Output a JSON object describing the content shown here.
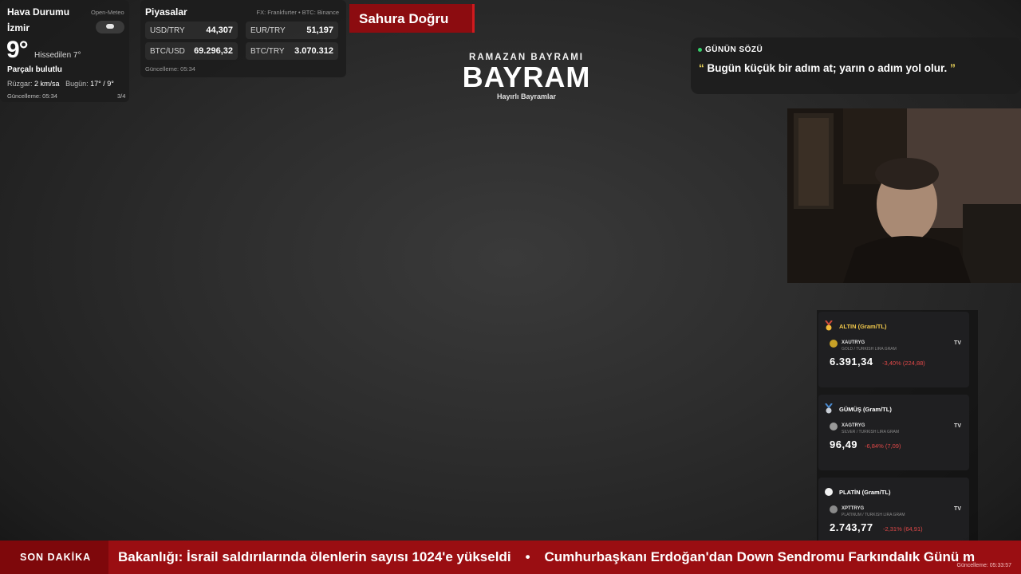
{
  "weather": {
    "title": "Hava Durumu",
    "source": "Open-Meteo",
    "city": "İzmir",
    "temperature": "9°",
    "feels_like": "Hissedilen 7°",
    "condition": "Parçalı bulutlu",
    "wind_label": "Rüzgar:",
    "wind_value": "2 km/sa",
    "today_label": "Bugün:",
    "today_value": "17° / 9°",
    "updated": "Güncelleme: 05:34",
    "page": "3/4",
    "icon": "partly-cloudy-icon"
  },
  "markets": {
    "title": "Piyasalar",
    "source": "FX: Frankfurter • BTC: Binance",
    "items": [
      {
        "label": "USD/TRY",
        "value": "44,307"
      },
      {
        "label": "EUR/TRY",
        "value": "51,197"
      },
      {
        "label": "BTC/USD",
        "value": "69.296,32"
      },
      {
        "label": "BTC/TRY",
        "value": "3.070.312"
      }
    ],
    "updated": "Güncelleme: 05:34"
  },
  "banner": {
    "sahura": "Sahura Doğru"
  },
  "center": {
    "subtitle": "RAMAZAN BAYRAMI",
    "title": "BAYRAM",
    "caption": "Hayırlı Bayramlar"
  },
  "quote": {
    "heading": "GÜNÜN SÖZÜ",
    "open_mark": "“",
    "text": "Bugün küçük bir adım at; yarın o adım yol olur.",
    "close_mark": "”"
  },
  "metals": [
    {
      "name": "ALTIN (Gram/TL)",
      "ticker": "XAUTRYG",
      "desc": "GOLD / TURKISH LIRA GRAM",
      "price": "6.391,34",
      "change": "-3,40% (224,88)",
      "name_color": "#f2c94c",
      "icon": "gold-medal-icon"
    },
    {
      "name": "GÜMÜŞ (Gram/TL)",
      "ticker": "XAGTRYG",
      "desc": "SILVER / TURKISH LIRA GRAM",
      "price": "96,49",
      "change": "-6,84% (7,09)",
      "name_color": "#ffffff",
      "icon": "silver-medal-icon"
    },
    {
      "name": "PLATİN (Gram/TL)",
      "ticker": "XPTTRYG",
      "desc": "PLATINUM / TURKISH LIRA GRAM",
      "price": "2.743,77",
      "change": "-2,31% (64,91)",
      "name_color": "#ffffff",
      "icon": "platinum-icon"
    }
  ],
  "metals_source_badge": "TV",
  "ticker": {
    "label": "SON DAKİKA",
    "items": [
      "Bakanlığı: İsrail saldırılarında ölenlerin sayısı 1024'e yükseldi",
      "Cumhurbaşkanı Erdoğan'dan Down Sendromu Farkındalık Günü m"
    ],
    "updated": "Güncelleme: 05:33:57"
  },
  "colors": {
    "ticker_red": "#9a0e12",
    "banner_red": "#8c0c10",
    "negative": "#e04848",
    "live_dot": "#35d06a"
  }
}
